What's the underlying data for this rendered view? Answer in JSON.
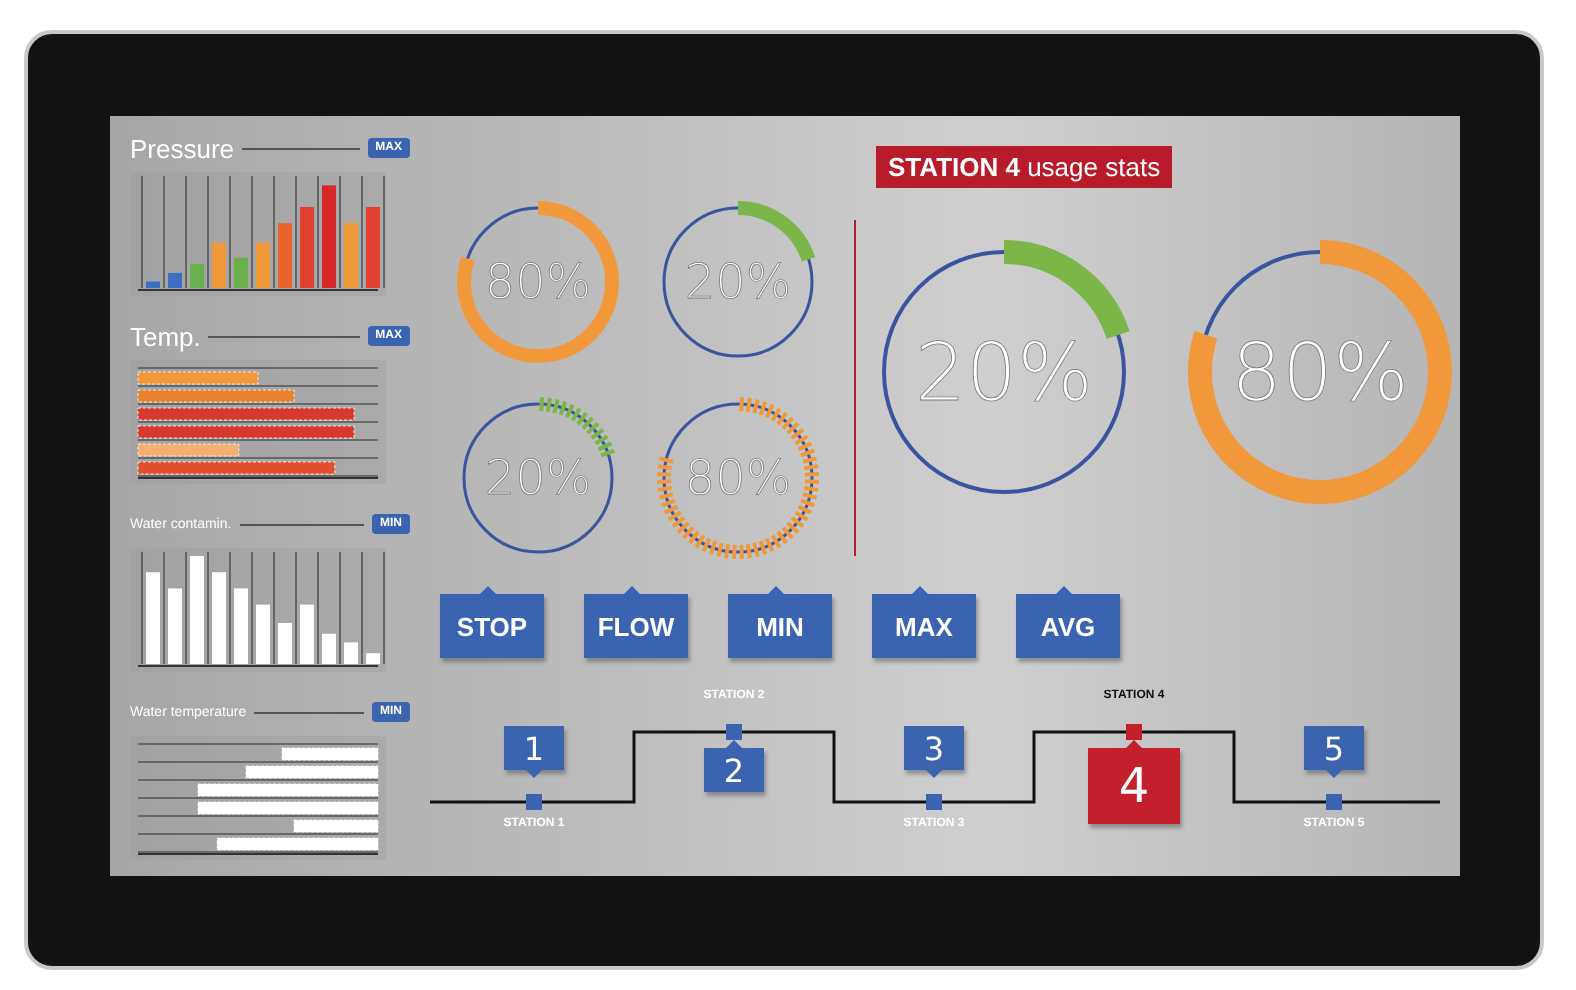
{
  "panels": [
    {
      "title": "Pressure",
      "badge": "MAX",
      "kind": "large"
    },
    {
      "title": "Temp.",
      "badge": "MAX",
      "kind": "large"
    },
    {
      "title": "Water contamin.",
      "badge": "MIN",
      "kind": "small"
    },
    {
      "title": "Water temperature",
      "badge": "MIN",
      "kind": "small"
    }
  ],
  "gauges": [
    {
      "value": "80%",
      "level": 0.8,
      "color": "#f0983a",
      "kind": "solid"
    },
    {
      "value": "20%",
      "level": 0.2,
      "color": "#7ab648",
      "kind": "solid"
    },
    {
      "value": "20%",
      "color": "#7ab648",
      "kind": "segmented"
    },
    {
      "value": "80%",
      "color": "#f0983a",
      "kind": "segmented"
    }
  ],
  "usage_stats": {
    "title": "**STATION 4** usage stats",
    "gauges": [
      {
        "value": "20%",
        "level": 0.2,
        "color": "#7ab648"
      },
      {
        "value": "80%",
        "level": 0.8,
        "color": "#f0983a"
      }
    ]
  },
  "buttons": [
    "STOP",
    "FLOW",
    "MIN",
    "MAX",
    "AVG"
  ],
  "stations": [
    {
      "label": "STATION 1",
      "number": "1",
      "kind": "low",
      "selected": false
    },
    {
      "label": "STATION 2",
      "number": "2",
      "kind": "high",
      "selected": false
    },
    {
      "label": "STATION 3",
      "number": "3",
      "kind": "low",
      "selected": false
    },
    {
      "label": "STATION 4",
      "number": "4",
      "kind": "high",
      "selected": true
    },
    {
      "label": "STATION 5",
      "number": "5",
      "kind": "low",
      "selected": false
    }
  ]
}
